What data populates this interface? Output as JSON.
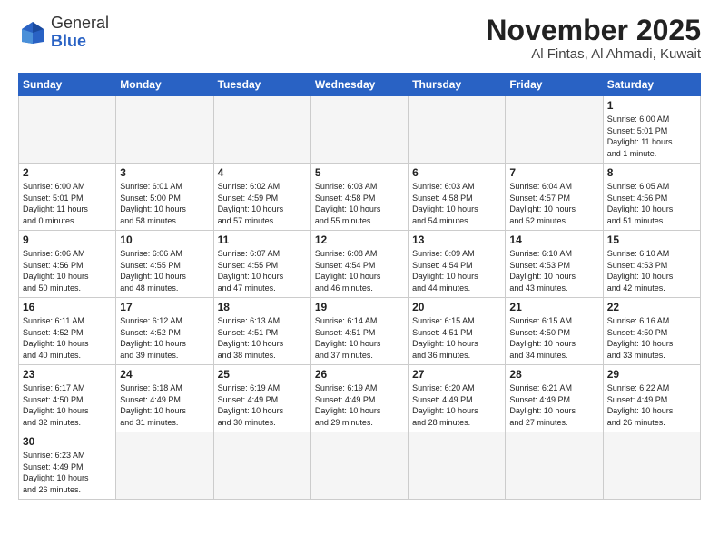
{
  "logo": {
    "text_general": "General",
    "text_blue": "Blue"
  },
  "header": {
    "month_title": "November 2025",
    "location": "Al Fintas, Al Ahmadi, Kuwait"
  },
  "weekdays": [
    "Sunday",
    "Monday",
    "Tuesday",
    "Wednesday",
    "Thursday",
    "Friday",
    "Saturday"
  ],
  "weeks": [
    [
      {
        "day": "",
        "info": "",
        "empty": true
      },
      {
        "day": "",
        "info": "",
        "empty": true
      },
      {
        "day": "",
        "info": "",
        "empty": true
      },
      {
        "day": "",
        "info": "",
        "empty": true
      },
      {
        "day": "",
        "info": "",
        "empty": true
      },
      {
        "day": "",
        "info": "",
        "empty": true
      },
      {
        "day": "1",
        "info": "Sunrise: 6:00 AM\nSunset: 5:01 PM\nDaylight: 11 hours\nand 1 minute."
      }
    ],
    [
      {
        "day": "2",
        "info": "Sunrise: 6:00 AM\nSunset: 5:01 PM\nDaylight: 11 hours\nand 0 minutes."
      },
      {
        "day": "3",
        "info": "Sunrise: 6:01 AM\nSunset: 5:00 PM\nDaylight: 10 hours\nand 58 minutes."
      },
      {
        "day": "4",
        "info": "Sunrise: 6:02 AM\nSunset: 4:59 PM\nDaylight: 10 hours\nand 57 minutes."
      },
      {
        "day": "5",
        "info": "Sunrise: 6:03 AM\nSunset: 4:58 PM\nDaylight: 10 hours\nand 55 minutes."
      },
      {
        "day": "6",
        "info": "Sunrise: 6:03 AM\nSunset: 4:58 PM\nDaylight: 10 hours\nand 54 minutes."
      },
      {
        "day": "7",
        "info": "Sunrise: 6:04 AM\nSunset: 4:57 PM\nDaylight: 10 hours\nand 52 minutes."
      },
      {
        "day": "8",
        "info": "Sunrise: 6:05 AM\nSunset: 4:56 PM\nDaylight: 10 hours\nand 51 minutes."
      }
    ],
    [
      {
        "day": "9",
        "info": "Sunrise: 6:06 AM\nSunset: 4:56 PM\nDaylight: 10 hours\nand 50 minutes."
      },
      {
        "day": "10",
        "info": "Sunrise: 6:06 AM\nSunset: 4:55 PM\nDaylight: 10 hours\nand 48 minutes."
      },
      {
        "day": "11",
        "info": "Sunrise: 6:07 AM\nSunset: 4:55 PM\nDaylight: 10 hours\nand 47 minutes."
      },
      {
        "day": "12",
        "info": "Sunrise: 6:08 AM\nSunset: 4:54 PM\nDaylight: 10 hours\nand 46 minutes."
      },
      {
        "day": "13",
        "info": "Sunrise: 6:09 AM\nSunset: 4:54 PM\nDaylight: 10 hours\nand 44 minutes."
      },
      {
        "day": "14",
        "info": "Sunrise: 6:10 AM\nSunset: 4:53 PM\nDaylight: 10 hours\nand 43 minutes."
      },
      {
        "day": "15",
        "info": "Sunrise: 6:10 AM\nSunset: 4:53 PM\nDaylight: 10 hours\nand 42 minutes."
      }
    ],
    [
      {
        "day": "16",
        "info": "Sunrise: 6:11 AM\nSunset: 4:52 PM\nDaylight: 10 hours\nand 40 minutes."
      },
      {
        "day": "17",
        "info": "Sunrise: 6:12 AM\nSunset: 4:52 PM\nDaylight: 10 hours\nand 39 minutes."
      },
      {
        "day": "18",
        "info": "Sunrise: 6:13 AM\nSunset: 4:51 PM\nDaylight: 10 hours\nand 38 minutes."
      },
      {
        "day": "19",
        "info": "Sunrise: 6:14 AM\nSunset: 4:51 PM\nDaylight: 10 hours\nand 37 minutes."
      },
      {
        "day": "20",
        "info": "Sunrise: 6:15 AM\nSunset: 4:51 PM\nDaylight: 10 hours\nand 36 minutes."
      },
      {
        "day": "21",
        "info": "Sunrise: 6:15 AM\nSunset: 4:50 PM\nDaylight: 10 hours\nand 34 minutes."
      },
      {
        "day": "22",
        "info": "Sunrise: 6:16 AM\nSunset: 4:50 PM\nDaylight: 10 hours\nand 33 minutes."
      }
    ],
    [
      {
        "day": "23",
        "info": "Sunrise: 6:17 AM\nSunset: 4:50 PM\nDaylight: 10 hours\nand 32 minutes."
      },
      {
        "day": "24",
        "info": "Sunrise: 6:18 AM\nSunset: 4:49 PM\nDaylight: 10 hours\nand 31 minutes."
      },
      {
        "day": "25",
        "info": "Sunrise: 6:19 AM\nSunset: 4:49 PM\nDaylight: 10 hours\nand 30 minutes."
      },
      {
        "day": "26",
        "info": "Sunrise: 6:19 AM\nSunset: 4:49 PM\nDaylight: 10 hours\nand 29 minutes."
      },
      {
        "day": "27",
        "info": "Sunrise: 6:20 AM\nSunset: 4:49 PM\nDaylight: 10 hours\nand 28 minutes."
      },
      {
        "day": "28",
        "info": "Sunrise: 6:21 AM\nSunset: 4:49 PM\nDaylight: 10 hours\nand 27 minutes."
      },
      {
        "day": "29",
        "info": "Sunrise: 6:22 AM\nSunset: 4:49 PM\nDaylight: 10 hours\nand 26 minutes."
      }
    ],
    [
      {
        "day": "30",
        "info": "Sunrise: 6:23 AM\nSunset: 4:49 PM\nDaylight: 10 hours\nand 26 minutes."
      },
      {
        "day": "",
        "info": "",
        "empty": true
      },
      {
        "day": "",
        "info": "",
        "empty": true
      },
      {
        "day": "",
        "info": "",
        "empty": true
      },
      {
        "day": "",
        "info": "",
        "empty": true
      },
      {
        "day": "",
        "info": "",
        "empty": true
      },
      {
        "day": "",
        "info": "",
        "empty": true
      }
    ]
  ]
}
